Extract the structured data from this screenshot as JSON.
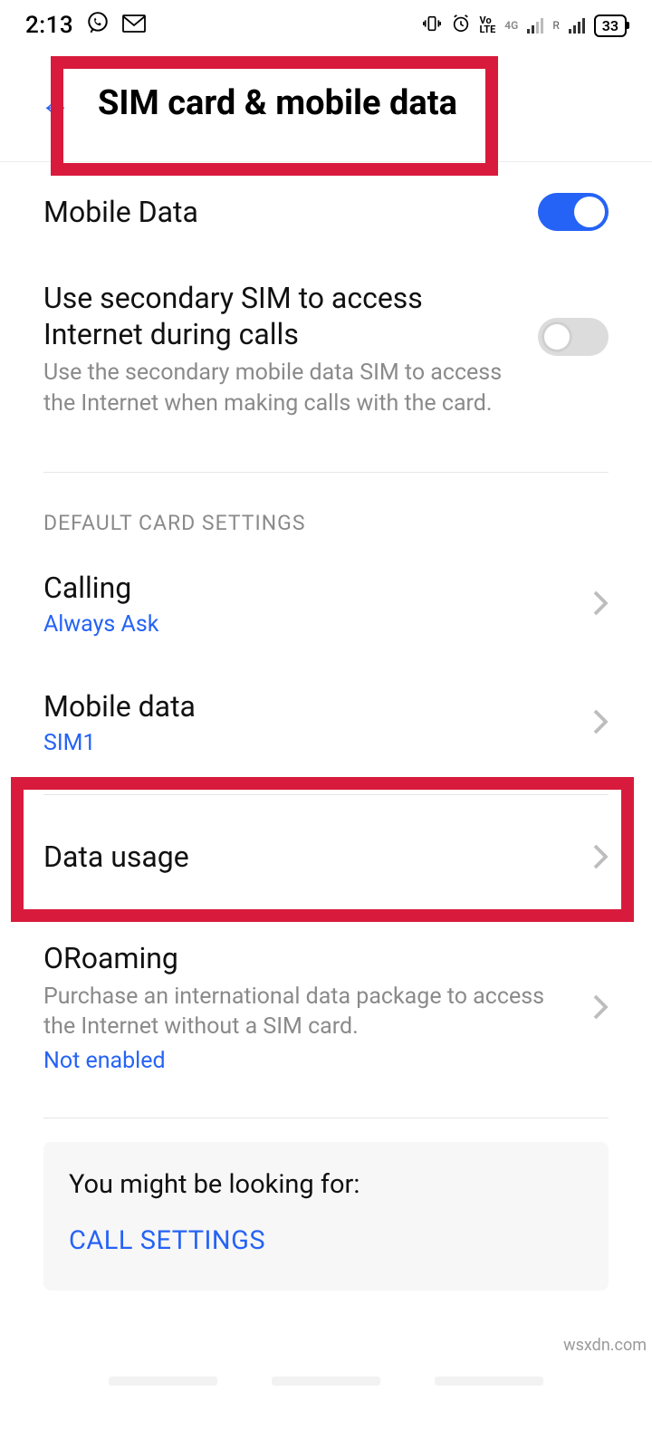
{
  "statusbar": {
    "time": "2:13",
    "leftIcons": {
      "whatsapp": "whatsapp-icon",
      "gmail": "gmail-icon"
    },
    "rightIcons": {
      "vibrate": "vibrate-icon",
      "alarm": "alarm-icon",
      "volte": "VoLTE",
      "net4g": "4G",
      "roam": "R"
    },
    "battery": "33"
  },
  "header": {
    "title": "SIM card & mobile data"
  },
  "settings": {
    "mobileData": {
      "label": "Mobile Data",
      "on": true
    },
    "secondarySim": {
      "label": "Use secondary SIM to access Internet during calls",
      "desc": "Use the secondary mobile data SIM to access the Internet when making calls with the card.",
      "on": false
    }
  },
  "sections": {
    "defaultCard": {
      "heading": "DEFAULT CARD SETTINGS",
      "calling": {
        "label": "Calling",
        "value": "Always Ask"
      },
      "mobileData": {
        "label": "Mobile data",
        "value": "SIM1"
      }
    }
  },
  "dataUsage": {
    "label": "Data usage"
  },
  "oroaming": {
    "label": "ORoaming",
    "desc": "Purchase an international data package to access the Internet without a SIM card.",
    "value": "Not enabled"
  },
  "suggestCard": {
    "title": "You might be looking for:",
    "link": "CALL SETTINGS"
  },
  "watermark": "wsxdn.com"
}
